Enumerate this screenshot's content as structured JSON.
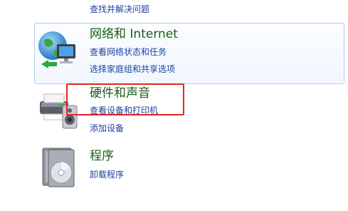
{
  "top_link": "查找并解决问题",
  "categories": [
    {
      "title": "网络和 Internet",
      "icon": "network-globe-icon",
      "links": [
        "查看网络状态和任务",
        "选择家庭组和共享选项"
      ]
    },
    {
      "title": "硬件和声音",
      "icon": "printer-speaker-icon",
      "links": [
        "查看设备和打印机",
        "添加设备"
      ]
    },
    {
      "title": "程序",
      "icon": "programs-disc-icon",
      "links": [
        "卸载程序"
      ]
    }
  ],
  "colors": {
    "link": "#1e3fa0",
    "category_title": "#1a5c1a",
    "highlight_border": "#e32424",
    "hover_border": "#b6d0ee"
  }
}
